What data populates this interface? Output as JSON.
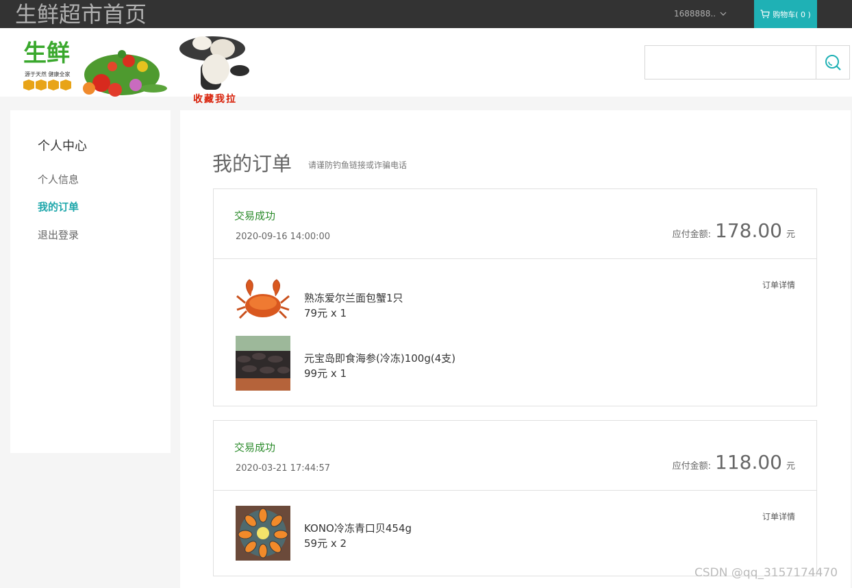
{
  "topbar": {
    "site_title": "生鲜超市首页",
    "username": "1688888..",
    "cart_label": "购物车( 0 )"
  },
  "header": {
    "banner_logo_text": "生鲜",
    "banner_slogan": "源于天然 健康全家",
    "favorite_text": "收藏我拉",
    "search": {
      "value": "",
      "placeholder": ""
    }
  },
  "sidebar": {
    "title": "个人中心",
    "items": [
      {
        "label": "个人信息",
        "active": false
      },
      {
        "label": "我的订单",
        "active": true
      },
      {
        "label": "退出登录",
        "active": false
      }
    ]
  },
  "main": {
    "title": "我的订单",
    "subtitle": "请谨防钓鱼链接或诈骗电话",
    "amount_label": "应付金额:",
    "amount_unit": "元",
    "detail_label": "订单详情",
    "orders": [
      {
        "status": "交易成功",
        "date": "2020-09-16 14:00:00",
        "amount": "178.00",
        "items": [
          {
            "name": "熟冻爱尔兰面包蟹1只",
            "price": "79元 x 1",
            "image": "crab"
          },
          {
            "name": "元宝岛即食海参(冷冻)100g(4支)",
            "price": "99元 x 1",
            "image": "sea-cucumber"
          }
        ]
      },
      {
        "status": "交易成功",
        "date": "2020-03-21 17:44:57",
        "amount": "118.00",
        "items": [
          {
            "name": "KONO冷冻青口贝454g",
            "price": "59元 x 2",
            "image": "mussels"
          }
        ]
      }
    ]
  },
  "watermark": "CSDN @qq_3157174470",
  "colors": {
    "accent": "#1fb1b5",
    "status_green": "#2a8a2a",
    "topbar": "#333333"
  }
}
